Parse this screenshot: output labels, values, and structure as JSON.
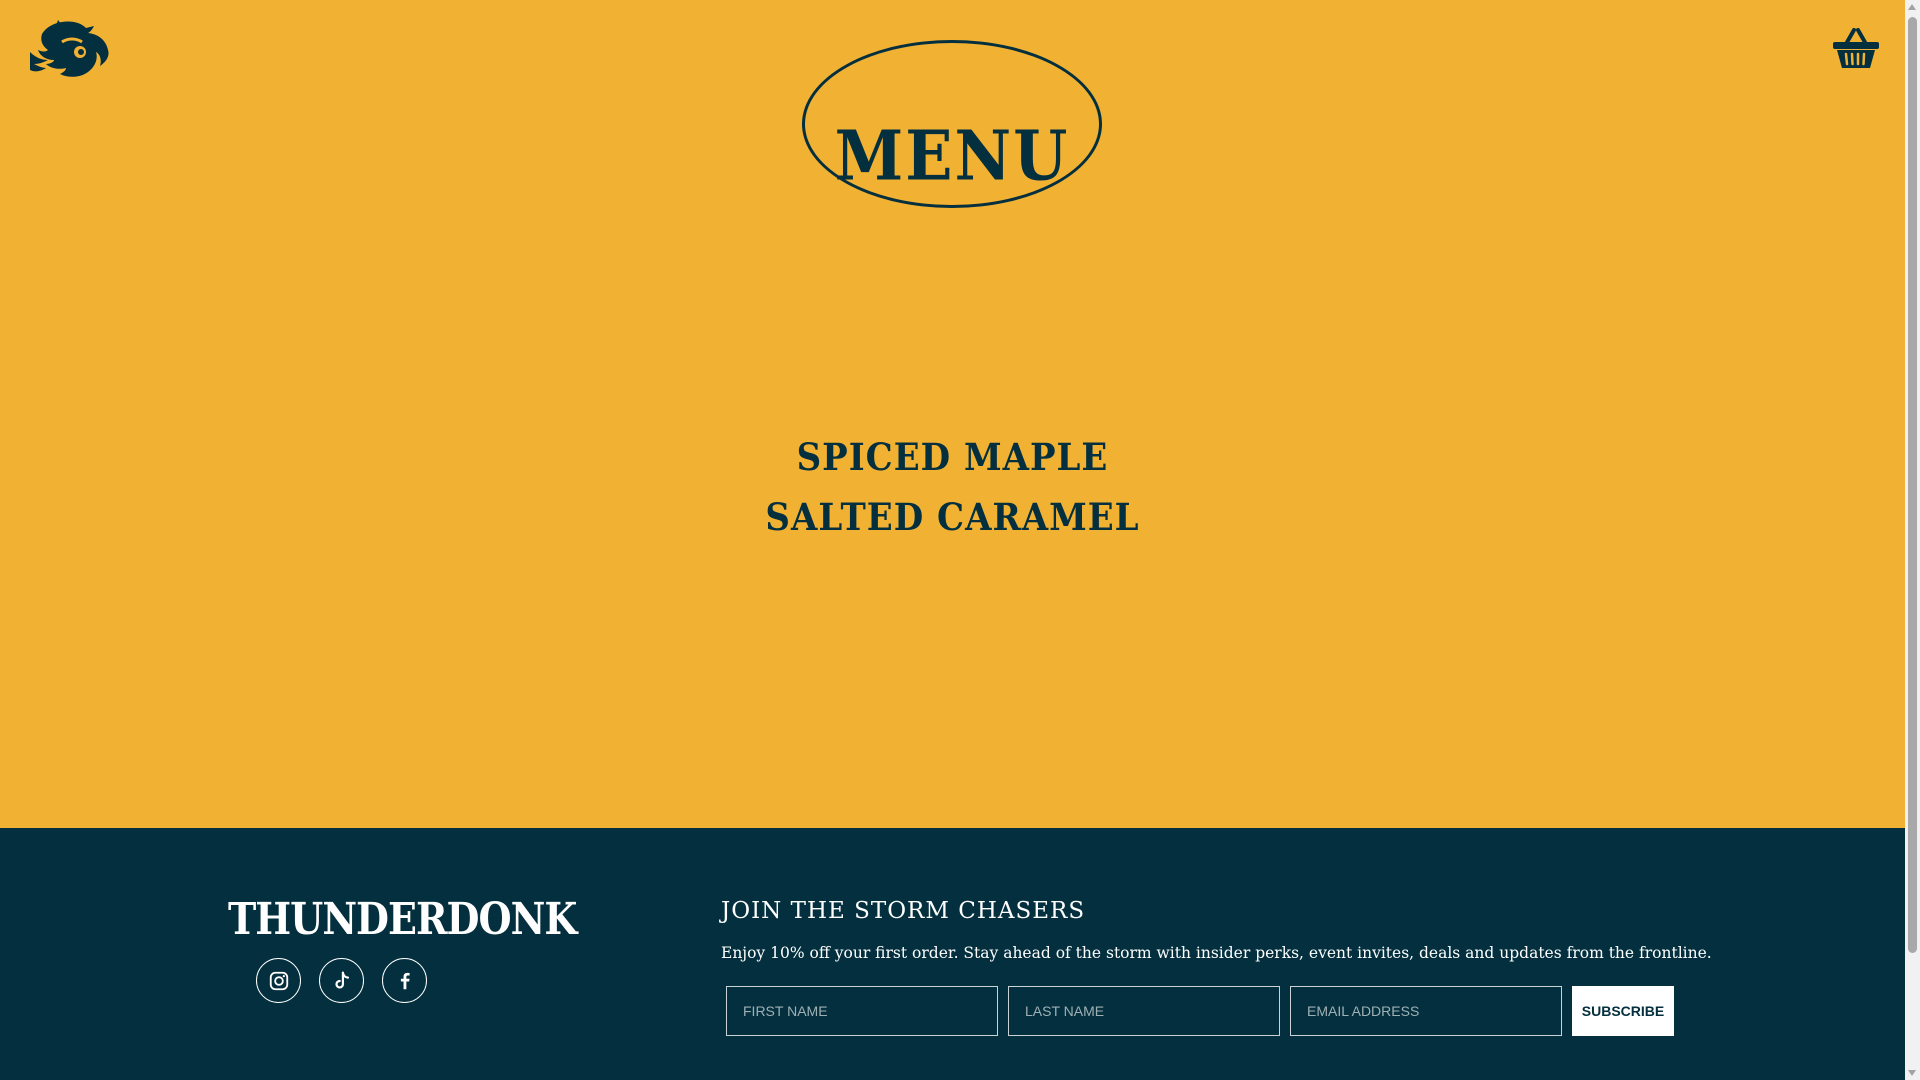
{
  "header": {
    "logo_icon": "thunderdonk-mascot-icon",
    "cart_icon": "basket-icon"
  },
  "page": {
    "title": "MENU"
  },
  "menu": {
    "items": [
      {
        "label": "SPICED MAPLE"
      },
      {
        "label": "SALTED CARAMEL"
      }
    ]
  },
  "footer": {
    "brand": "THUNDERDONK",
    "socials": [
      {
        "icon": "instagram-icon"
      },
      {
        "icon": "tiktok-icon"
      },
      {
        "icon": "facebook-icon"
      }
    ],
    "signup": {
      "heading": "JOIN THE STORM CHASERS",
      "text": "Enjoy 10% off your first order. Stay ahead of the storm with insider perks, event invites, deals and updates from the frontline.",
      "first_name_placeholder": "FIRST NAME",
      "last_name_placeholder": "LAST NAME",
      "email_placeholder": "EMAIL ADDRESS",
      "button_label": "SUBSCRIBE"
    }
  },
  "colors": {
    "background": "#F1B133",
    "ink": "#032F3E",
    "footer_bg": "#032F3E",
    "footer_text": "#FFFFFF"
  }
}
